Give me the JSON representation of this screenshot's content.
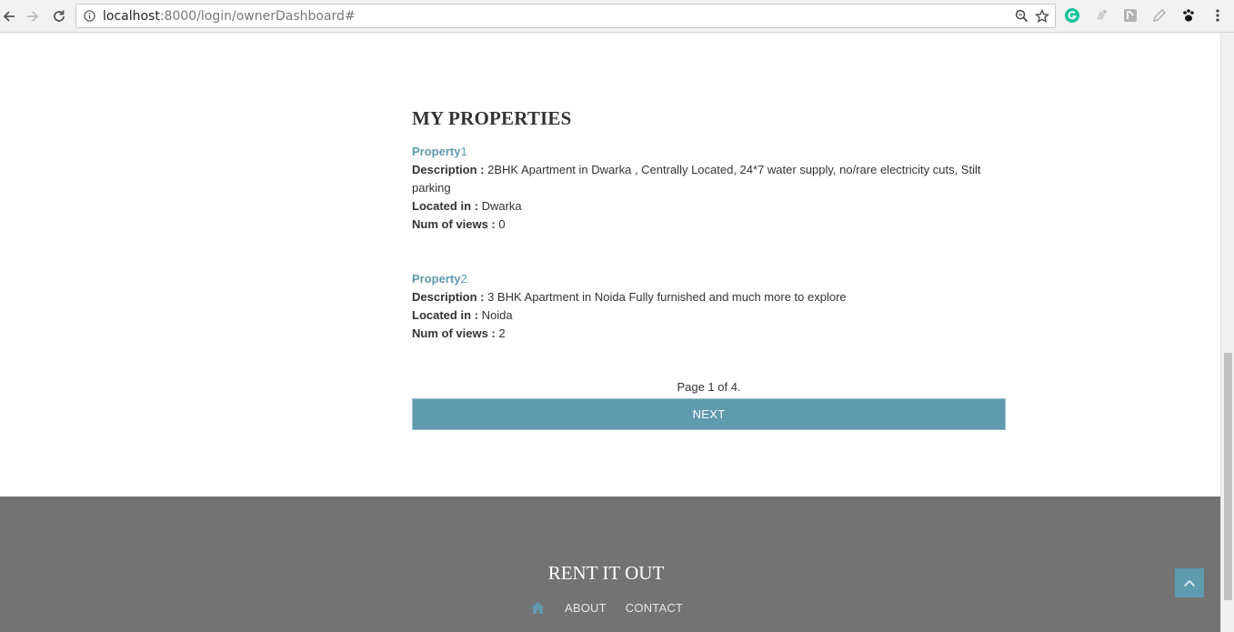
{
  "browser": {
    "url_host": "localhost",
    "url_rest": ":8000/login/ownerDashboard#",
    "icons": [
      "back-arrow-icon",
      "forward-arrow-icon",
      "reload-icon",
      "info-icon",
      "zoom-icon",
      "star-icon",
      "grammarly-icon",
      "extension-icon",
      "extension-icon",
      "pencil-icon",
      "paw-icon",
      "menu-icon"
    ]
  },
  "main": {
    "section_title": "MY PROPERTIES",
    "properties": [
      {
        "title_prefix": "Property",
        "title_num": "1",
        "desc_label": "Description :",
        "desc_value": "2BHK Apartment in Dwarka , Centrally Located, 24*7 water supply, no/rare electricity cuts, Stilt parking",
        "loc_label": "Located in :",
        "loc_value": "Dwarka",
        "views_label": "Num of views :",
        "views_value": "0"
      },
      {
        "title_prefix": "Property",
        "title_num": "2",
        "desc_label": "Description :",
        "desc_value": "3 BHK Apartment in Noida Fully furnished and much more to explore",
        "loc_label": "Located in :",
        "loc_value": "Noida",
        "views_label": "Num of views :",
        "views_value": "2"
      }
    ],
    "pagination": {
      "text": "Page 1 of 4.",
      "next_label": "NEXT"
    }
  },
  "footer": {
    "title": "RENT IT OUT",
    "nav": [
      "ABOUT",
      "CONTACT"
    ]
  },
  "colors": {
    "accent": "#5f9aaf",
    "footer_bg": "#737373"
  }
}
